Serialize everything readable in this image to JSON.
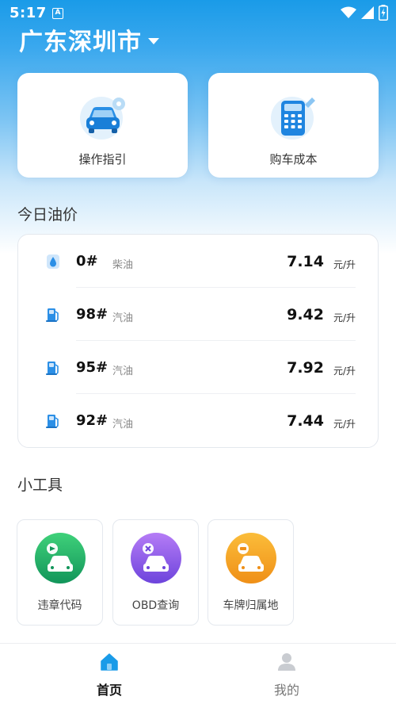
{
  "status_bar": {
    "time": "5:17",
    "notification_glyph": "A"
  },
  "header": {
    "city": "广东深圳市"
  },
  "quick_actions": [
    {
      "label": "操作指引",
      "icon": "car-guide-icon"
    },
    {
      "label": "购车成本",
      "icon": "calculator-icon"
    }
  ],
  "oil_section": {
    "title": "今日油价",
    "rows": [
      {
        "grade": "0#",
        "type": "柴油",
        "price": "7.14",
        "unit": "元/升",
        "icon": "oil-drop-icon"
      },
      {
        "grade": "98#",
        "type": "汽油",
        "price": "9.42",
        "unit": "元/升",
        "icon": "fuel-pump-icon"
      },
      {
        "grade": "95#",
        "type": "汽油",
        "price": "7.92",
        "unit": "元/升",
        "icon": "fuel-pump-icon"
      },
      {
        "grade": "92#",
        "type": "汽油",
        "price": "7.44",
        "unit": "元/升",
        "icon": "fuel-pump-icon"
      }
    ]
  },
  "tools_section": {
    "title": "小工具",
    "items": [
      {
        "label": "违章代码",
        "icon": "violation-code-icon",
        "color_top": "#3fd17a",
        "color_bottom": "#12955a"
      },
      {
        "label": "OBD查询",
        "icon": "obd-query-icon",
        "color_top": "#b57cf6",
        "color_bottom": "#6d44dc"
      },
      {
        "label": "车牌归属地",
        "icon": "plate-location-icon",
        "color_top": "#fbbd3a",
        "color_bottom": "#ef8f17"
      }
    ]
  },
  "bottom_nav": {
    "home_label": "首页",
    "mine_label": "我的"
  },
  "colors": {
    "accent": "#1a9be8"
  }
}
